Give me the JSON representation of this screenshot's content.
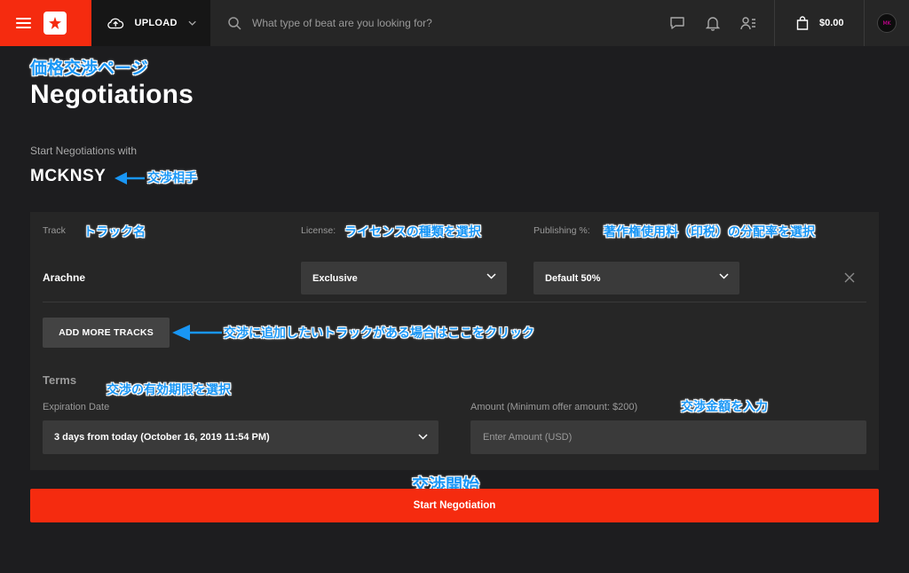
{
  "colors": {
    "accent": "#f52b0f",
    "annotation": "#1996f5",
    "background": "#1d1d1f",
    "panel": "#262626",
    "field": "#3a3a3a"
  },
  "topbar": {
    "upload_label": "UPLOAD",
    "search_placeholder": "What type of beat are you looking for?",
    "cart_total": "$0.00",
    "icons": [
      "menu-icon",
      "beatstars-logo",
      "cloud-upload-icon",
      "chevron-down-icon",
      "search-icon",
      "chat-icon",
      "bell-icon",
      "user-list-icon",
      "shopping-bag-icon",
      "avatar"
    ]
  },
  "page": {
    "title": "Negotiations",
    "subtitle": "Start Negotiations with",
    "partner": "MCKNSY"
  },
  "track_row": {
    "labels": {
      "track": "Track",
      "license": "License:",
      "publishing": "Publishing %:"
    },
    "track_name": "Arachne",
    "license_value": "Exclusive",
    "publishing_value": "Default 50%",
    "add_more_label": "ADD MORE TRACKS"
  },
  "terms": {
    "heading": "Terms",
    "expiration_label": "Expiration Date",
    "expiration_value": "3 days from today (October 16, 2019 11:54 PM)",
    "amount_label": "Amount (Minimum offer amount: $200)",
    "amount_placeholder": "Enter Amount (USD)"
  },
  "submit_label": "Start Negotiation",
  "annotations": {
    "page": "価格交渉ページ",
    "partner": "交渉相手",
    "track": "トラック名",
    "license": "ライセンスの種類を選択",
    "publishing": "著作権使用料（印税）の分配率を選択",
    "add_tracks": "交渉に追加したいトラックがある場合はここをクリック",
    "expiration": "交渉の有効期限を選択",
    "amount": "交渉金額を入力",
    "start": "交渉開始"
  }
}
